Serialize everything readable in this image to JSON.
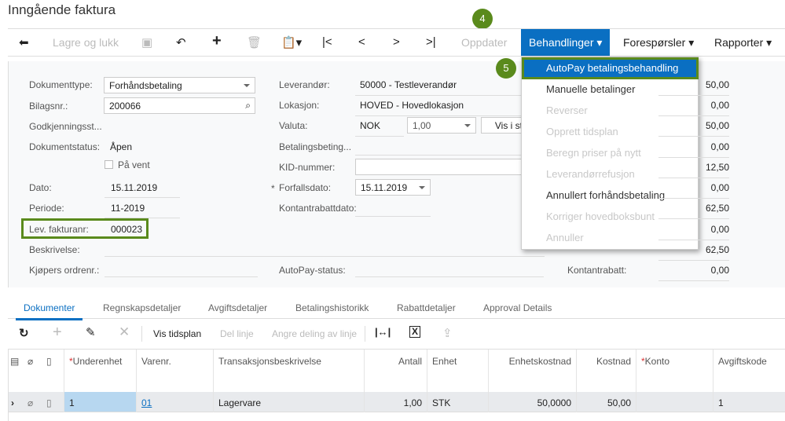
{
  "title": "Inngående faktura",
  "toolbar": {
    "save_close": "Lagre og lukk",
    "refresh": "Oppdater",
    "actions": "Behandlinger",
    "inquiries": "Forespørsler",
    "reports": "Rapporter"
  },
  "badges": {
    "step4": "4",
    "step5": "5"
  },
  "form": {
    "doc_type_label": "Dokumenttype:",
    "doc_type": "Forhåndsbetaling",
    "ref_label": "Bilagsnr.:",
    "ref": "200066",
    "approval_label": "Godkjenningsst...",
    "status_label": "Dokumentstatus:",
    "status": "Åpen",
    "hold_label": "På vent",
    "date_label": "Dato:",
    "date": "15.11.2019",
    "period_label": "Periode:",
    "period": "11-2019",
    "vendor_ref_label": "Lev. fakturanr:",
    "vendor_ref": "000023",
    "desc_label": "Beskrivelse:",
    "buyer_label": "Kjøpers ordrenr.:",
    "vendor_label": "Leverandør:",
    "vendor": "50000 - Testleverandør",
    "location_label": "Lokasjon:",
    "location": "HOVED - Hovedlokasjon",
    "currency_label": "Valuta:",
    "currency": "NOK",
    "rate": "1,00",
    "view_base": "Vis i st",
    "terms_label": "Betalingsbeting...",
    "kid_label": "KID-nummer:",
    "due_label": "Forfallsdato:",
    "due": "15.11.2019",
    "cash_disc_date_label": "Kontantrabattdato:",
    "autopay_label": "AutoPay-status:",
    "cash_disc_label": "Kontantrabatt:"
  },
  "summary_values": [
    "50,00",
    "0,00",
    "50,00",
    "0,00",
    "12,50",
    "0,00",
    "62,50",
    "0,00",
    "62,50",
    "0,00"
  ],
  "menu": [
    {
      "label": "AutoPay betalingsbehandling",
      "enabled": true,
      "selected": true
    },
    {
      "label": "Manuelle betalinger",
      "enabled": true
    },
    {
      "label": "Reverser",
      "enabled": false
    },
    {
      "label": "Opprett tidsplan",
      "enabled": false
    },
    {
      "label": "Beregn priser på nytt",
      "enabled": false
    },
    {
      "label": "Leverandørrefusjon",
      "enabled": false
    },
    {
      "label": "Annullert forhåndsbetaling",
      "enabled": true
    },
    {
      "label": "Korriger hovedboksbunt",
      "enabled": false
    },
    {
      "label": "Annuller",
      "enabled": false
    }
  ],
  "tabs": [
    "Dokumenter",
    "Regnskapsdetaljer",
    "Avgiftsdetaljer",
    "Betalingshistorikk",
    "Rabattdetaljer",
    "Approval Details"
  ],
  "grid_toolbar": {
    "schedule": "Vis tidsplan",
    "split": "Del linje",
    "undo_split": "Angre deling av linje"
  },
  "grid": {
    "headers": [
      "Underenhet",
      "Varenr.",
      "Transaksjonsbeskrivelse",
      "Antall",
      "Enhet",
      "Enhetskostnad",
      "Kostnad",
      "Konto",
      "Avgiftskode"
    ],
    "row": [
      "1",
      "01",
      "Lagervare",
      "1,00",
      "STK",
      "50,0000",
      "50,00",
      "",
      "1"
    ]
  },
  "colors": {
    "accent": "#0a6fc2",
    "badge": "#5a8a1c",
    "highlight": "#b7d7f0"
  }
}
